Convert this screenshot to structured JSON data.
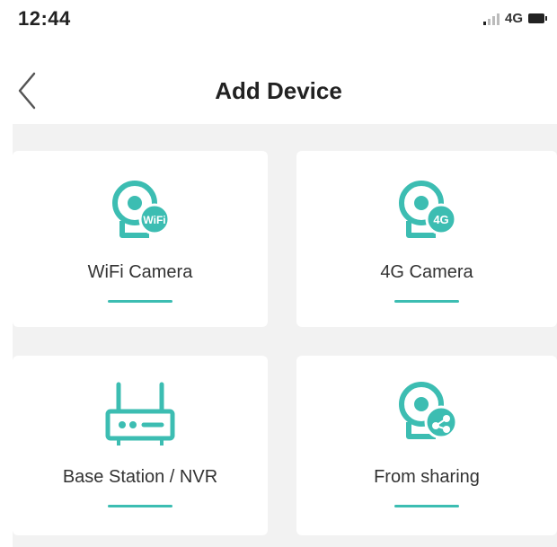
{
  "status_bar": {
    "time": "12:44",
    "network": "4G"
  },
  "nav": {
    "title": "Add Device"
  },
  "options": [
    {
      "label": "WiFi Camera",
      "icon": "wifi-camera-icon",
      "badge": "WiFi"
    },
    {
      "label": "4G Camera",
      "icon": "4g-camera-icon",
      "badge": "4G"
    },
    {
      "label": "Base Station / NVR",
      "icon": "base-station-icon"
    },
    {
      "label": "From sharing",
      "icon": "shared-camera-icon"
    }
  ],
  "colors": {
    "accent": "#3cbdb2",
    "background": "#f2f2f2"
  }
}
